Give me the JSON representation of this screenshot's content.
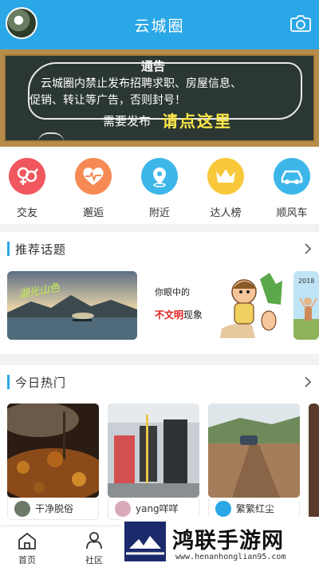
{
  "header": {
    "title": "云城圈"
  },
  "banner": {
    "heading": "通告",
    "line1": "云城圈内禁止发布招聘求职、房屋信息、",
    "line2": "促销、转让等广告，否则封号！",
    "line3": "需要发布",
    "highlight": "请点这里"
  },
  "features": [
    {
      "label": "交友",
      "color": "#f0575f"
    },
    {
      "label": "邂逅",
      "color": "#f58a55"
    },
    {
      "label": "附近",
      "color": "#3db6ea"
    },
    {
      "label": "达人榜",
      "color": "#f8c83a"
    },
    {
      "label": "顺风车",
      "color": "#3db6ea"
    }
  ],
  "recommended": {
    "title": "推荐话题",
    "topics": [
      {
        "text": "湖光山色"
      },
      {
        "text_a": "你眼中的",
        "text_b": "不文明",
        "text_c": "现象"
      },
      {
        "text": "2018"
      }
    ]
  },
  "hot": {
    "title": "今日热门",
    "posts": [
      {
        "user": "干净脱俗"
      },
      {
        "user": "yang咩咩"
      },
      {
        "user": "繁繁红尘"
      }
    ]
  },
  "tabbar": {
    "home": "首页",
    "community": "社区"
  },
  "watermark": {
    "text": "鸿联手游网",
    "url": "www.henanhonglian95.com"
  },
  "colors": {
    "primary": "#2aa7e6",
    "board": "#2b3733",
    "frame": "#b88d4a"
  }
}
